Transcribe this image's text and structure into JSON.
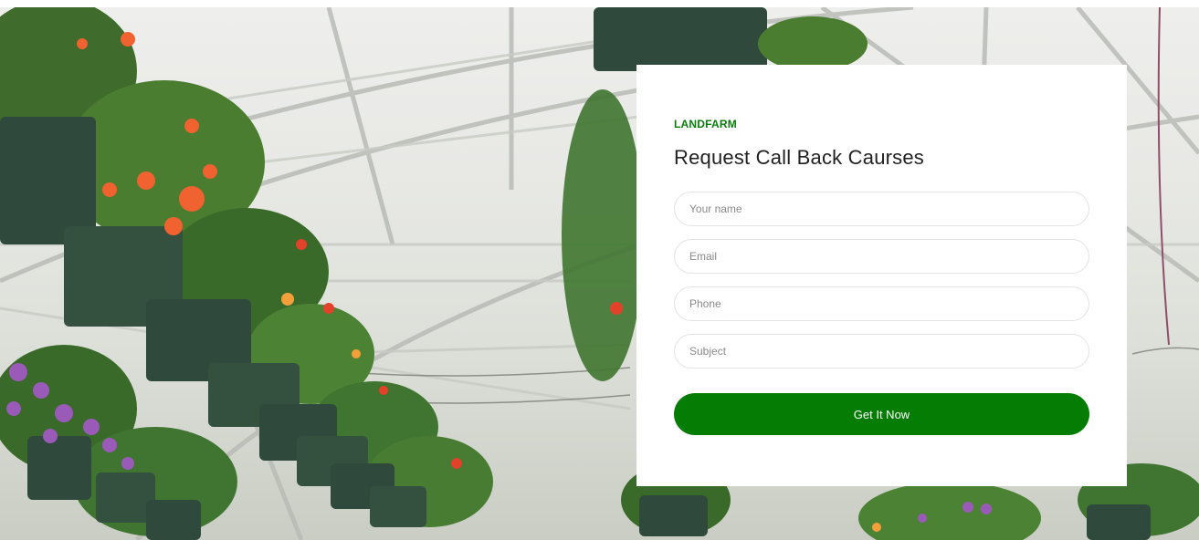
{
  "form": {
    "brand": "LANDFARM",
    "title": "Request Call Back Caurses",
    "fields": {
      "name": {
        "value": "",
        "placeholder": "Your name"
      },
      "email": {
        "value": "",
        "placeholder": "Email"
      },
      "phone": {
        "value": "",
        "placeholder": "Phone"
      },
      "subject": {
        "value": "",
        "placeholder": "Subject"
      }
    },
    "submit_label": "Get It Now"
  },
  "colors": {
    "accent": "#057d05",
    "brand_text": "#0a7d0a",
    "card_background": "#ffffff",
    "pot_green": "#2f4a3c"
  }
}
